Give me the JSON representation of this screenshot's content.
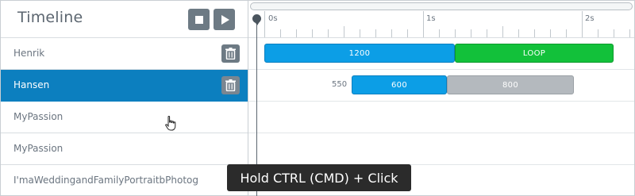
{
  "timeline": {
    "title": "Timeline",
    "stop_icon": "stop-icon",
    "play_icon": "play-icon"
  },
  "rows": [
    {
      "label": "Henrik",
      "selected": false,
      "has_trash": true
    },
    {
      "label": "Hansen",
      "selected": true,
      "has_trash": true
    },
    {
      "label": "MyPassion",
      "selected": false,
      "has_trash": false
    },
    {
      "label": "MyPassion",
      "selected": false,
      "has_trash": false
    },
    {
      "label": "I'maWeddingandFamilyPortraitbPhotog",
      "selected": false,
      "has_trash": false
    }
  ],
  "ruler": {
    "labels": [
      "0s",
      "1s",
      "2s"
    ]
  },
  "tracks": [
    {
      "segments": [
        {
          "text": "1200",
          "color": "blue"
        },
        {
          "text": "LOOP",
          "color": "green"
        }
      ]
    },
    {
      "delay": "550",
      "segments": [
        {
          "text": "600",
          "color": "blue"
        },
        {
          "text": "800",
          "color": "gray"
        }
      ]
    }
  ],
  "tooltip": {
    "text": "Hold CTRL (CMD) + Click"
  },
  "colors": {
    "selected_row": "#0c7fbf",
    "blue_segment": "#0c9ee6",
    "green_segment": "#12c13a",
    "gray_segment": "#b4b9be",
    "button": "#6d7a84"
  }
}
